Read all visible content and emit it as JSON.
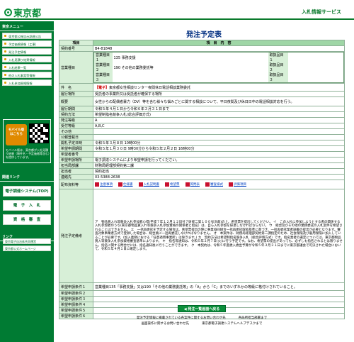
{
  "header": {
    "logo_text": "東京都",
    "service_title": "入札情報サービス"
  },
  "sidebar": {
    "menu_title": "東京メニュー",
    "items": [
      "東京都公報告示調達公告",
      "予定価格情報（工事）",
      "発注予定情報",
      "入札見積り結果情報",
      "入札結果一覧",
      "他の入札事案等情報",
      "入札参加資格情報"
    ],
    "mobile_button": "モバイル版",
    "mobile_button_sub": "はこちら",
    "mobile_text": "モバイル版は、東京都が入札見積り結果（物件名・予定価格等含む）を提供しています。",
    "related_title": "関連リンク",
    "big_buttons": [
      "電子調達システム(TOP)",
      "電　子　入　札",
      "資　格　審　査"
    ],
    "link_title": "リンク",
    "links": [
      "東京電子自治体共同運営",
      "東京都公式ホームページ"
    ]
  },
  "main": {
    "title": "発注予定表",
    "header_item": "項目",
    "header_content": "項　目　内　容",
    "contract_no_label": "契約番号",
    "contract_no": "B4-81848",
    "business_type_label": "営業種目",
    "business_rows": [
      {
        "kind": "営業種目１",
        "name": "135 事務支援",
        "field": "取扱品目１"
      },
      {
        "kind": "営業種目２",
        "name": "190 その他の業務委託等",
        "field": "取扱品目２"
      },
      {
        "kind": "営業種目３",
        "name": "",
        "field": "取扱品目３"
      }
    ],
    "subject_label": "件　名",
    "subject_badge": "【電子】",
    "subject": "東京都女性相談センター夜間休日電話相談業務委託",
    "location_label": "履行場所",
    "location": "受託者の事業所又は受託者が確保する場所",
    "summary_label": "概要",
    "summary": "女性からの配偶者暴力（DV）等を含む様々な悩みごとに関する相談について、平日夜間及び休日日中の電話相談対応を行う。",
    "period_label": "履行期間",
    "period": "令和５年４月１日から令和６年３月３１日まで",
    "method_label": "契約方法",
    "method": "希望制指名競争入札(総合評価方式)",
    "rank_label": "発注等級",
    "rank": "A",
    "reception_label": "受付等級",
    "reception": "A,B,C",
    "other_label": "その他",
    "announce_label": "公報登載日",
    "opening_label": "開札予定日時",
    "opening": "令和５年３月８日 10時00分",
    "apply_period_label": "希望申請期間",
    "apply_period": "令和５年１月３０日 9時30分から令和５年２月２日 16時00分",
    "apply_no_label": "希望者番号",
    "apply_method_label": "希望申請場所",
    "apply_method": "電子調達システムにより希望申請を行ってください。",
    "dept_label": "担当局部課",
    "dept": "財務局経理部契約第二課",
    "person_label": "担当者",
    "person": "契約担当",
    "contact_label": "連絡先",
    "contact": "03-5388-2638",
    "docs_label": "配布資料等",
    "docs": [
      "注意事項",
      "仕様書",
      "入札説明書",
      "希望票",
      "質問表",
      "審査様式",
      "評価項目"
    ],
    "remarks_label": "発注予定備考",
    "remarks": "ア　物品買入れ等競争入札参加者心得(平成７年１２月１２日付７財経二第１００号決裁)の上、希望票を提出してください。\nイ　この入札に参加しようとする者の関係する入札参加者のうち(東京都物品買入れ等競争入札参加資格の関係者と指名）は、自ら入札参加を辞退しなければならない。\nウ　総合及びその他の業務委託の入札案件を希望されることはできません。\nエ　一括再委託を予定する場合は、希望票提出の際に事業協同組合一括再委託取扱基準に基づき、一括再委託業者調書の提出が必要となります。審査対象事業者方式で登録した場合は、総合員に一括再委託しなければなりません。\nオ　本案件は、財務局経理部契約第二課指定のため、社会保険及び雇用保険に加入していることが必要です。(加入義務における「任意適用事業所」は除きます。)\nカ　契約方法は希望制指名競争入札（総合評価方式）です。指名業者の選定については、東京都物品買入等競争入札参加資格審査基準によります。\nキ　指名等通知は、令和５年２月７日(火)に行う予定です。なお、希望票の提出があっても、必ずしも指名されるとは限りません。指名に関する問合せには、指名通知後に行うことができます。\nク　本契約は、令和５年度歳入歳出予算が令和５年３月３１日までに東京都議会で可決された場合において、令和５年４月１日に確定します。",
    "condition_rows": [
      "希望申請条件１",
      "希望申請条件２",
      "希望申請条件３",
      "希望申請条件４",
      "希望申請条件５",
      "希望申請条件６"
    ],
    "condition1": "営業種目135「事務支援」又は190「その他の業務委託等」の「A」から「C」までのいずれかの等級に格付けされていること。",
    "back_button": "発注一覧画面へ戻る"
  },
  "footer": {
    "line1_left": "発注予定情報に掲載されている各案件に関するお問い合わせ先",
    "line1_right": "各局所担当部署まで",
    "line2_left": "画面操作に関するお問い合わせ先",
    "line2_right": "東京都電子調達システムヘルプデスクまで"
  },
  "colors": {
    "primary": "#007b33",
    "title": "#002e80",
    "link": "#0040c0",
    "label_bg": "#d7efd7"
  }
}
